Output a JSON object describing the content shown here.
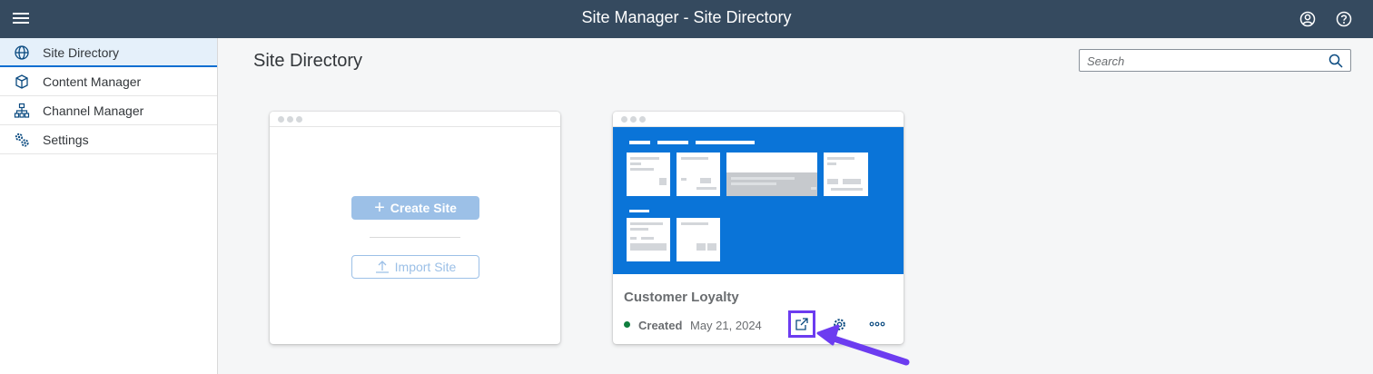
{
  "shell": {
    "title": "Site Manager - Site Directory",
    "icons": [
      "menu-icon",
      "user-icon",
      "help-icon"
    ]
  },
  "sidebar": {
    "items": [
      {
        "label": "Site Directory",
        "icon": "globe-icon",
        "selected": true
      },
      {
        "label": "Content Manager",
        "icon": "cube-icon",
        "selected": false
      },
      {
        "label": "Channel Manager",
        "icon": "hierarchy-icon",
        "selected": false
      },
      {
        "label": "Settings",
        "icon": "gears-icon",
        "selected": false
      }
    ]
  },
  "main": {
    "title": "Site Directory",
    "search": {
      "placeholder": "Search",
      "value": ""
    },
    "create_card": {
      "create_label": "Create Site",
      "import_label": "Import Site"
    },
    "sites": [
      {
        "name": "Customer Loyalty",
        "status": "Created",
        "date": "May 21, 2024",
        "actions": [
          "launch-icon",
          "settings-icon",
          "more-icon"
        ]
      }
    ]
  },
  "colors": {
    "shell_bg": "#354a5f",
    "accent": "#0a6ed1",
    "preview_bg": "#0a74d8",
    "status_created": "#107e3e",
    "highlight": "#6c3cf0"
  }
}
